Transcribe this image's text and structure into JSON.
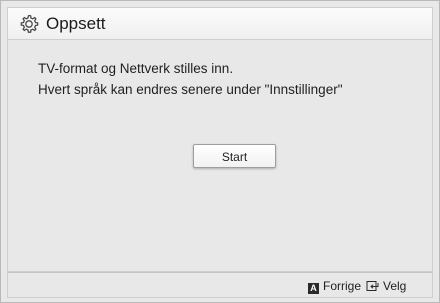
{
  "header": {
    "title": "Oppsett",
    "icon": "gear-icon"
  },
  "main": {
    "line1": "TV-format og Nettverk stilles inn.",
    "line2": "Hvert språk kan endres senere under \"Innstillinger\"",
    "start_label": "Start"
  },
  "footer": {
    "back_key": "A",
    "back_label": "Forrige",
    "select_label": "Velg"
  },
  "colors": {
    "background": "#e8e8e8",
    "header": "#f5f5f5",
    "key": "#2a2a2a"
  }
}
